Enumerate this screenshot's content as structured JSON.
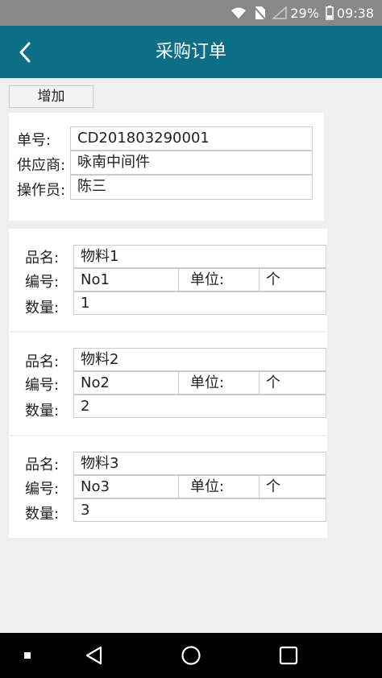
{
  "status_bar": {
    "battery": "29%",
    "time": "09:38"
  },
  "app_bar": {
    "title": "采购订单"
  },
  "toolbar": {
    "add_label": "增加"
  },
  "order": {
    "order_no_label": "单号:",
    "order_no": "CD201803290001",
    "supplier_label": "供应商:",
    "supplier": "咏南中间件",
    "operator_label": "操作员:",
    "operator": "陈三"
  },
  "labels": {
    "name": "品名:",
    "code": "编号:",
    "unit": "单位:",
    "qty": "数量:"
  },
  "items": [
    {
      "name": "物料1",
      "code": "No1",
      "unit": "个",
      "qty": "1"
    },
    {
      "name": "物料2",
      "code": "No2",
      "unit": "个",
      "qty": "2"
    },
    {
      "name": "物料3",
      "code": "No3",
      "unit": "个",
      "qty": "3"
    }
  ]
}
